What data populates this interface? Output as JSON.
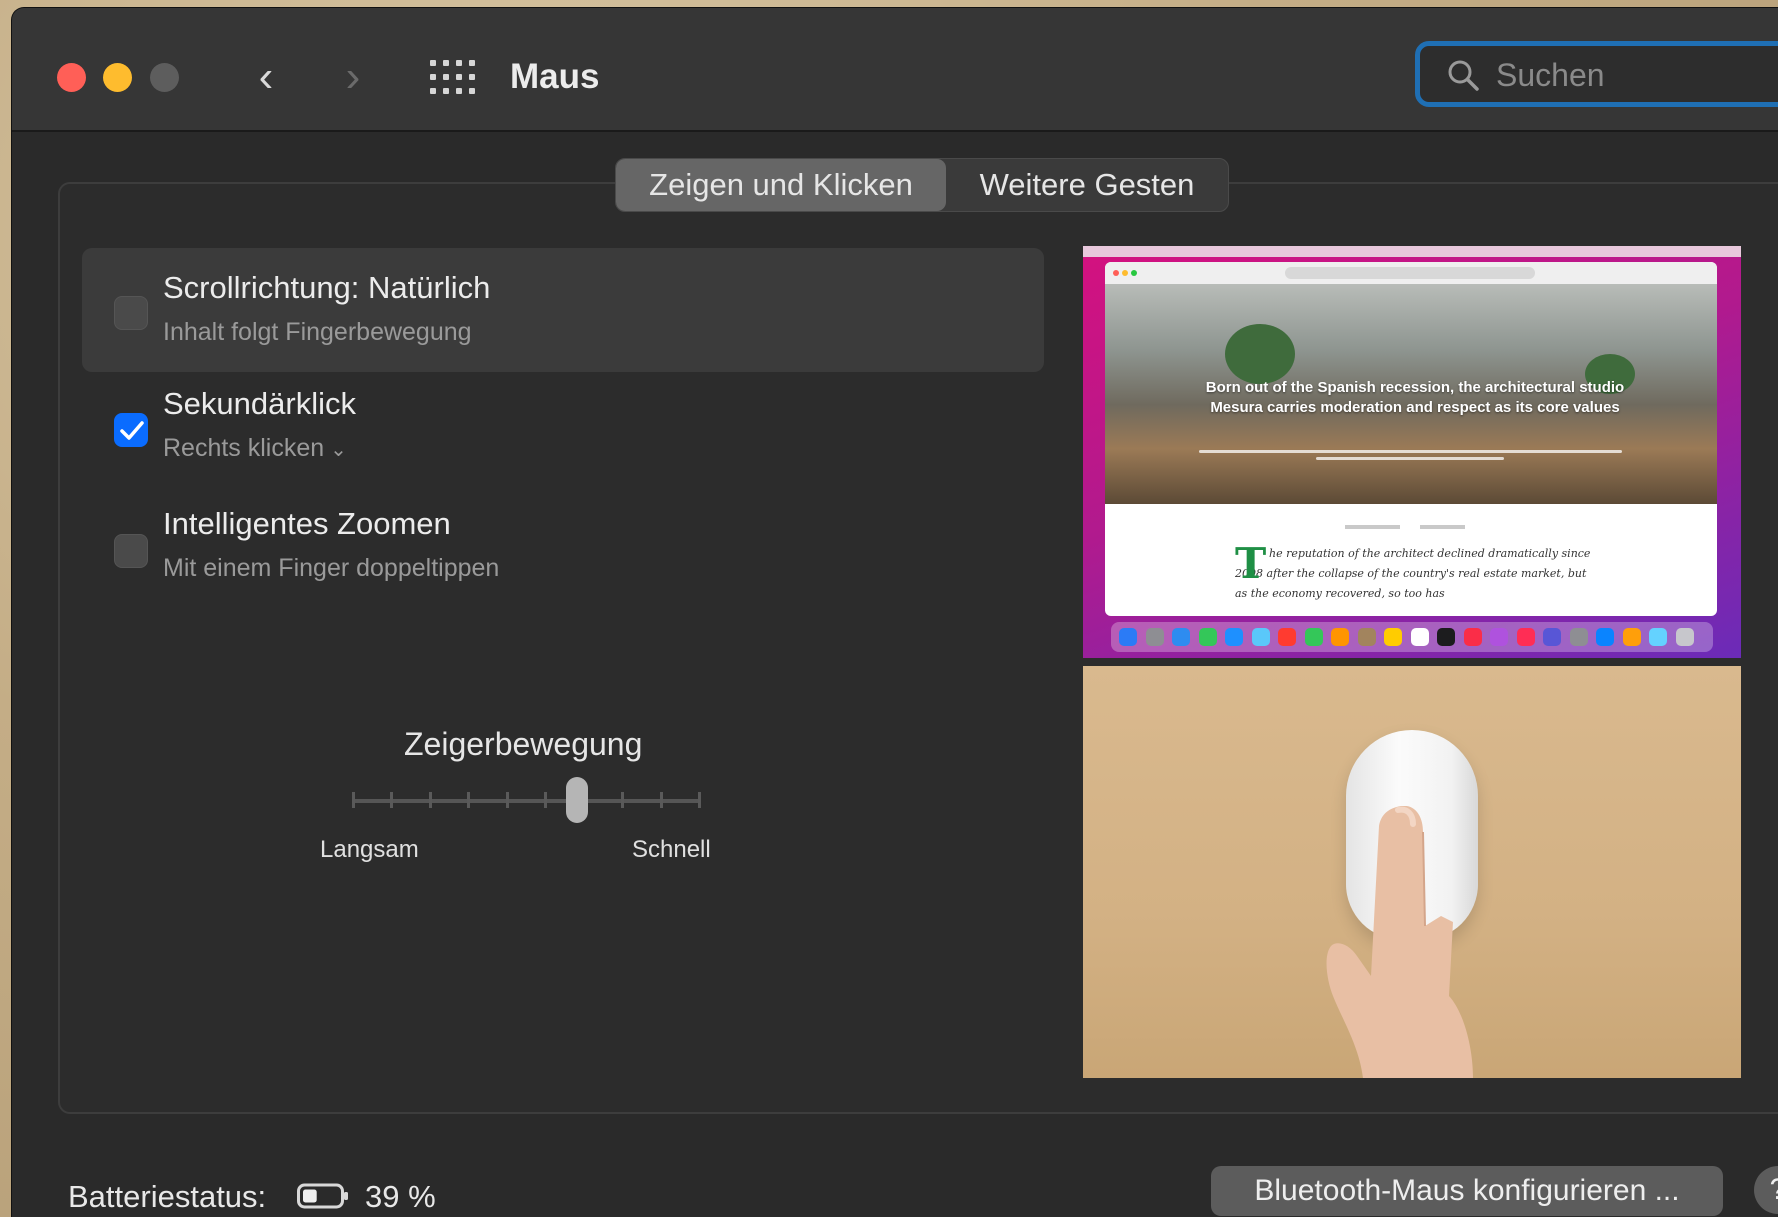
{
  "window": {
    "title": "Maus",
    "nav_back_glyph": "‹",
    "nav_forward_glyph": "›"
  },
  "search": {
    "placeholder": "Suchen",
    "value": ""
  },
  "tabs": [
    {
      "label": "Zeigen und Klicken",
      "active": true
    },
    {
      "label": "Weitere Gesten",
      "active": false
    }
  ],
  "options": [
    {
      "title": "Scrollrichtung: Natürlich",
      "subtitle": "Inhalt folgt Fingerbewegung",
      "checked": false
    },
    {
      "title": "Sekundärklick",
      "subtitle": "Rechts klicken",
      "checked": true,
      "has_dropdown": true
    },
    {
      "title": "Intelligentes Zoomen",
      "subtitle": "Mit einem Finger doppeltippen",
      "checked": false
    }
  ],
  "slider": {
    "label": "Zeigerbewegung",
    "min_label": "Langsam",
    "max_label": "Schnell",
    "ticks": 10,
    "value": 0.65
  },
  "preview": {
    "hero_text": "Born out of the Spanish recession, the architectural studio Mesura carries moderation and respect as its core values",
    "dropcap": "T",
    "article_text": "he reputation of the architect declined dramatically since 2008 after the collapse of the country's real estate market, but as the economy recovered, so too has"
  },
  "footer": {
    "battery_label": "Batteriestatus:",
    "battery_value": "39 %",
    "battery_level": 0.39,
    "bluetooth_button": "Bluetooth-Maus konfigurieren ...",
    "help_button": "?"
  },
  "colors": {
    "accent": "#0a6cff",
    "search_focus": "#1f6fb4",
    "close": "#ff5f57",
    "minimize": "#febc2e"
  },
  "icons": [
    "close-icon",
    "minimize-icon",
    "zoom-icon",
    "back-chevron-icon",
    "forward-chevron-icon",
    "grid-icon",
    "search-icon",
    "checkmark-icon",
    "chevron-down-icon",
    "battery-icon"
  ]
}
